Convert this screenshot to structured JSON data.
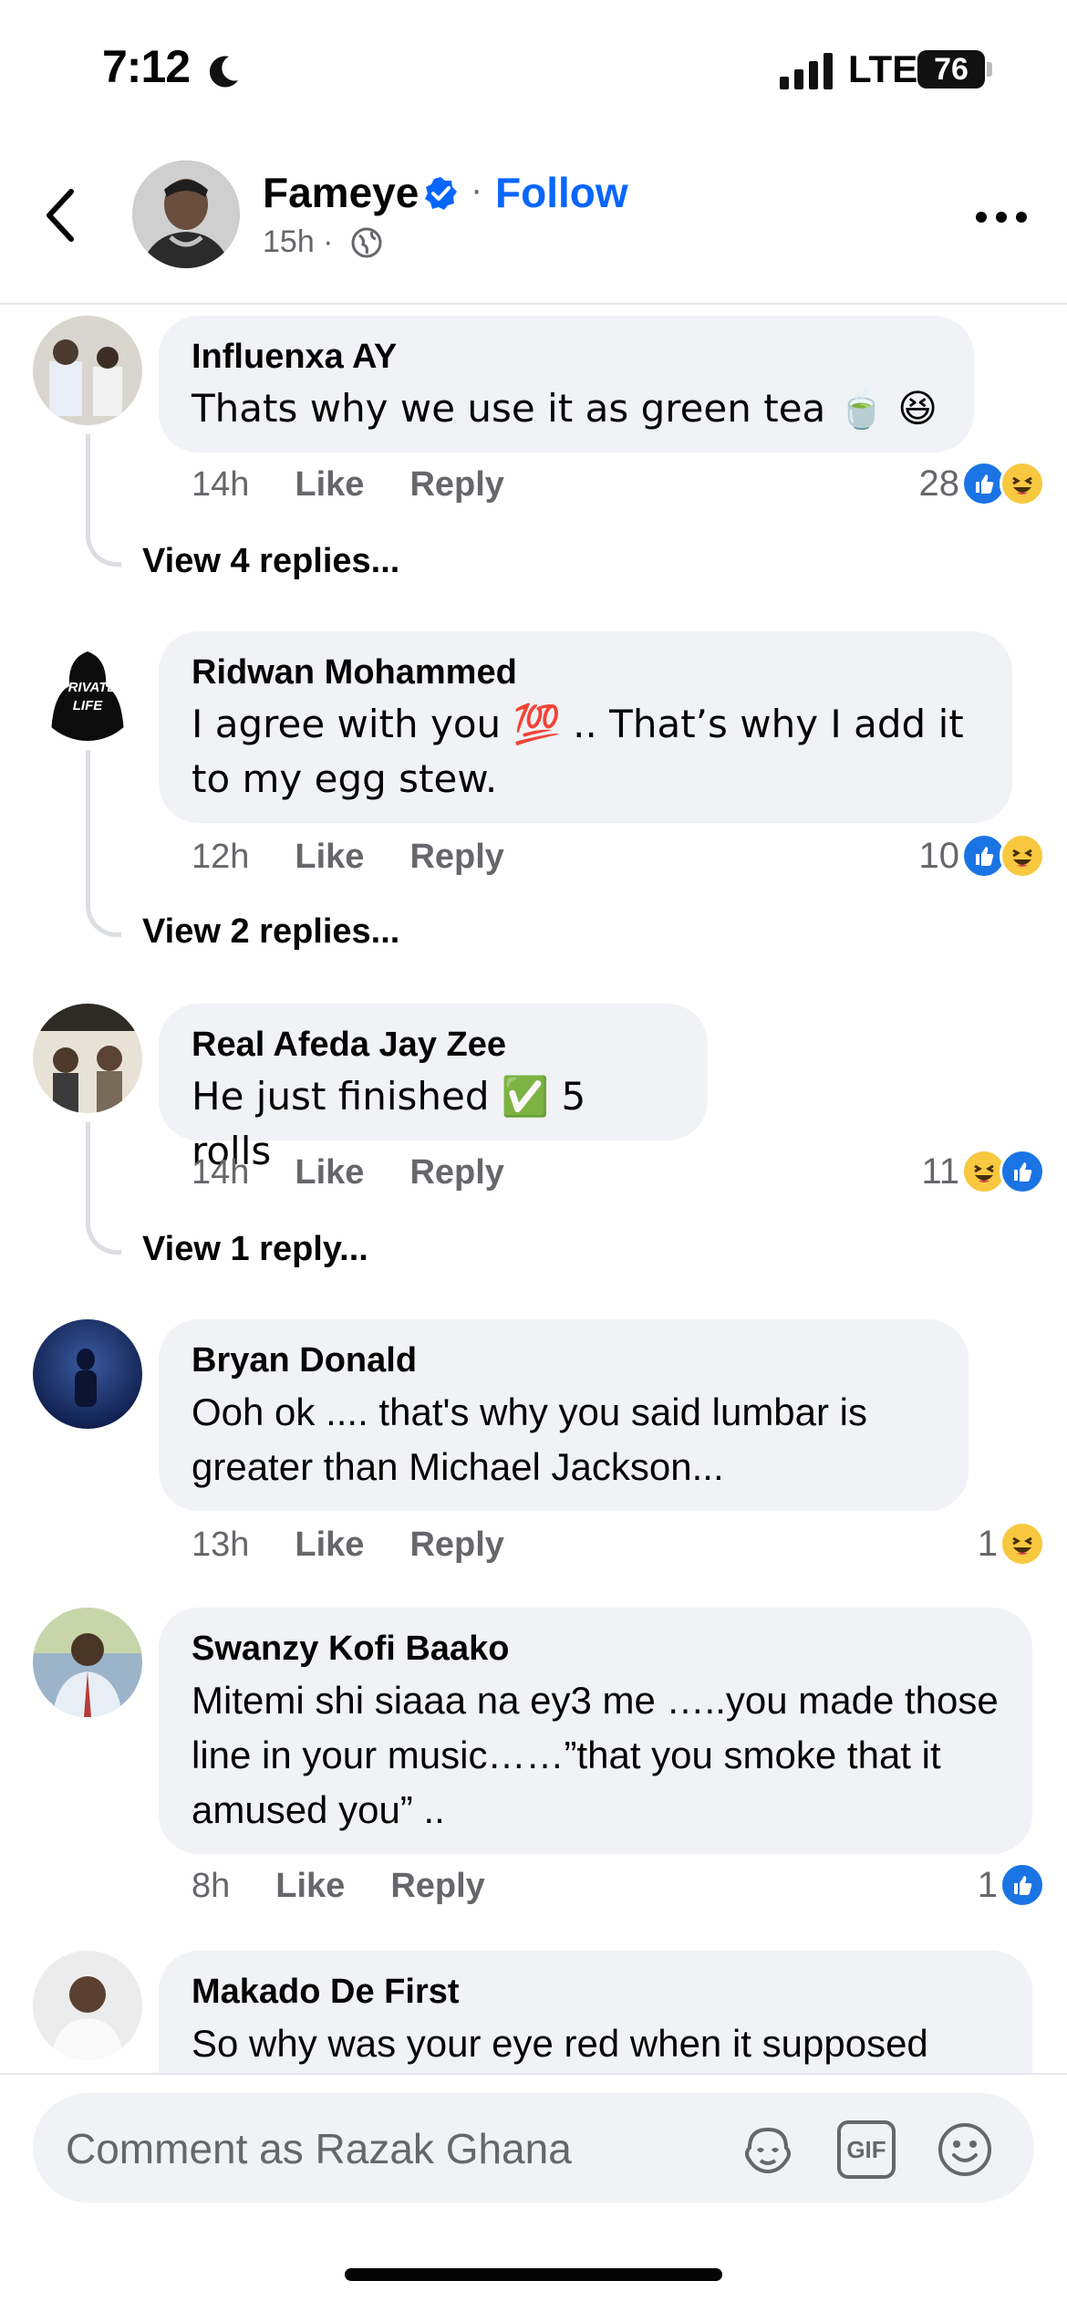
{
  "status": {
    "time": "7:12",
    "network": "LTE",
    "battery": "76"
  },
  "header": {
    "page_name": "Fameye",
    "separator": "·",
    "follow_label": "Follow",
    "post_time": "15h ·"
  },
  "comments": [
    {
      "author": "Influenxa AY",
      "text": "Thats why we use it as green tea 🍵 😆",
      "time": "14h",
      "like_label": "Like",
      "reply_label": "Reply",
      "reaction_count": "28",
      "reactions": [
        "like-icon",
        "haha-icon"
      ],
      "view_replies": "View 4 replies..."
    },
    {
      "author": "Ridwan Mohammed",
      "text": "I agree with you 💯 .. That’s why I add it to my egg stew.",
      "time": "12h",
      "like_label": "Like",
      "reply_label": "Reply",
      "reaction_count": "10",
      "reactions": [
        "like-icon",
        "haha-icon"
      ],
      "view_replies": "View 2 replies...",
      "avatar_text": [
        "PRIVATE",
        "LIFE"
      ]
    },
    {
      "author": "Real Afeda Jay Zee",
      "text": "He just finished ✅ 5 rolls",
      "time": "14h",
      "like_label": "Like",
      "reply_label": "Reply",
      "reaction_count": "11",
      "reactions": [
        "haha-icon",
        "like-icon"
      ],
      "view_replies": "View 1 reply..."
    },
    {
      "author": "Bryan Donald",
      "text": "Ooh ok .... that's why you said lumbar is greater than Michael Jackson...",
      "time": "13h",
      "like_label": "Like",
      "reply_label": "Reply",
      "reaction_count": "1",
      "reactions": [
        "haha-icon"
      ]
    },
    {
      "author": "Swanzy Kofi Baako",
      "text": "Mitemi shi siaaa na ey3 me …..you made those line in your music……”that you smoke that it amused you” ..",
      "time": "8h",
      "like_label": "Like",
      "reply_label": "Reply",
      "reaction_count": "1",
      "reactions": [
        "like-icon"
      ]
    },
    {
      "author": "Makado De First",
      "text": "So why was your eye red when it supposed"
    }
  ],
  "composer": {
    "placeholder": "Comment as Razak Ghana",
    "gif_label": "GIF"
  },
  "colors": {
    "accent": "#0866ff",
    "bubble": "#f0f2f5",
    "secondary_text": "#65676b",
    "like": "#1b74e4",
    "haha": "#f7c840"
  }
}
